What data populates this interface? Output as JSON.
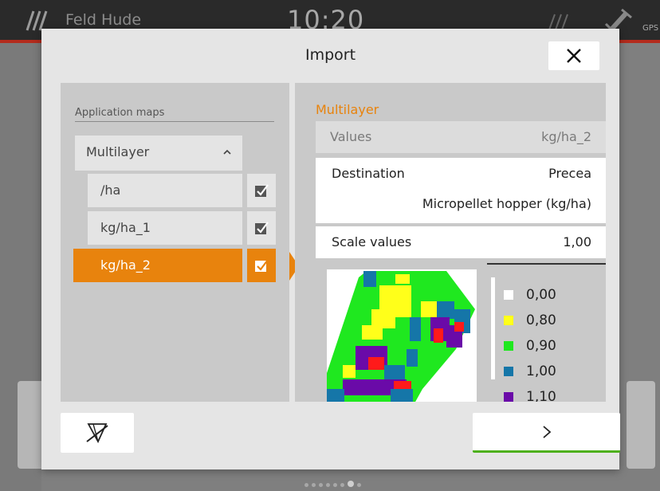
{
  "status_bar": {
    "field_name": "Feld Hude",
    "time": "10:20",
    "gps_label": "GPS"
  },
  "dialog": {
    "title": "Import",
    "close_icon": "close-icon",
    "left": {
      "section_label": "Application maps",
      "group": {
        "label": "Multilayer",
        "expanded": true
      },
      "items": [
        {
          "label": "/ha",
          "checked": true,
          "selected": false
        },
        {
          "label": "kg/ha_1",
          "checked": true,
          "selected": false
        },
        {
          "label": "kg/ha_2",
          "checked": true,
          "selected": true
        }
      ]
    },
    "right": {
      "title": "Multilayer",
      "values_label": "Values",
      "values_value": "kg/ha_2",
      "destination_label": "Destination",
      "destination_value": "Precea",
      "destination_sub": "Micropellet hopper (kg/ha)",
      "scale_label": "Scale values",
      "scale_value": "1,00",
      "legend": [
        {
          "label": "0,00",
          "color": "#ffffff"
        },
        {
          "label": "0,80",
          "color": "#ffff1a"
        },
        {
          "label": "0,90",
          "color": "#1fe81f"
        },
        {
          "label": "1,00",
          "color": "#1576a8"
        },
        {
          "label": "1,10",
          "color": "#6a0aa8"
        }
      ]
    },
    "footer": {
      "left_icon": "no-section-control-icon",
      "right_icon": "chevron-right-icon",
      "accent": "#4db01c"
    }
  },
  "colors": {
    "accent_orange": "#e8830d",
    "red_line": "#b32b1d",
    "map_red": "#ff1a1a"
  }
}
